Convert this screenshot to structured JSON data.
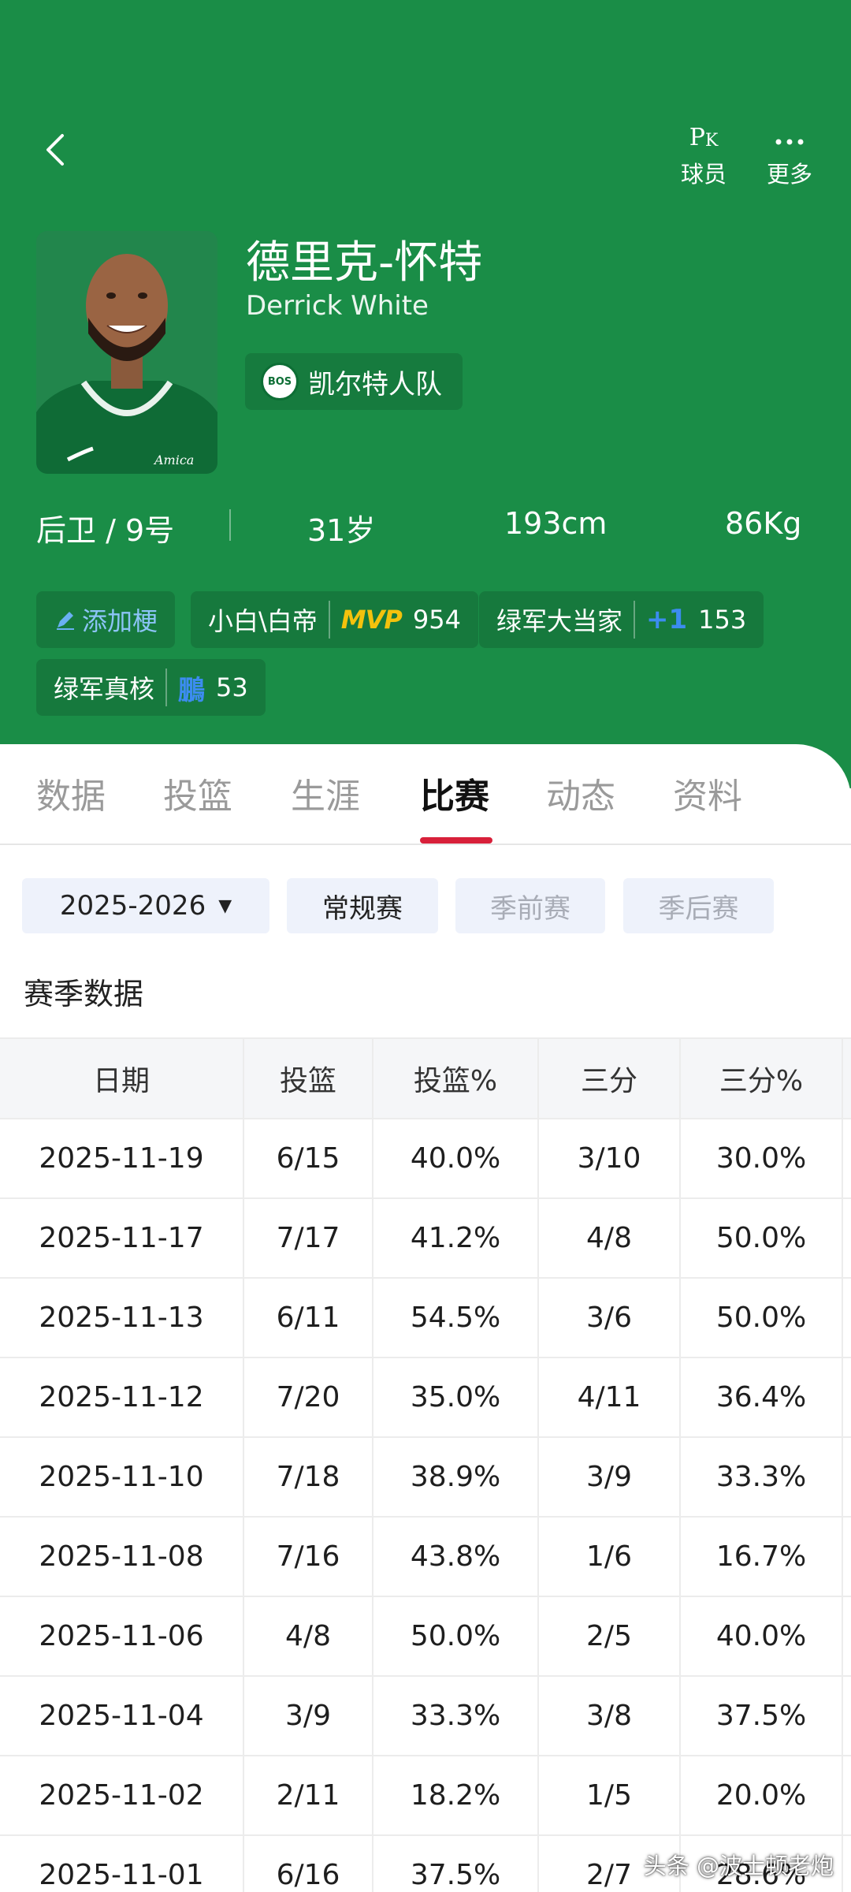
{
  "header": {
    "back_icon": "chevron-left-icon",
    "pk_button": {
      "icon": "pk-icon",
      "label": "球员"
    },
    "more_button": {
      "icon": "more-dots-icon",
      "label": "更多"
    },
    "accent": "#1a8d47"
  },
  "player": {
    "name_cn": "德里克-怀特",
    "name_en": "Derrick White",
    "team": "凯尔特人队",
    "team_logo_text": "BOS",
    "position_number": "后卫 / 9号",
    "age": "31岁",
    "height": "193cm",
    "weight": "86Kg"
  },
  "tags": {
    "add": "添加梗",
    "items": [
      {
        "label": "小白\\白帝",
        "badge": "MVP",
        "count": "954"
      },
      {
        "label": "绿军大当家",
        "badge": "+1",
        "count": "153"
      },
      {
        "label": "绿军真核",
        "badge": "鵬",
        "count": "53"
      }
    ]
  },
  "tabs": [
    {
      "label": "数据",
      "active": false
    },
    {
      "label": "投篮",
      "active": false
    },
    {
      "label": "生涯",
      "active": false
    },
    {
      "label": "比赛",
      "active": true
    },
    {
      "label": "动态",
      "active": false
    },
    {
      "label": "资料",
      "active": false
    }
  ],
  "filters": {
    "season": "2025-2026",
    "types": [
      "常规赛",
      "季前赛",
      "季后赛"
    ],
    "selected_type": "常规赛"
  },
  "section_title": "赛季数据",
  "table": {
    "columns": [
      "日期",
      "投篮",
      "投篮%",
      "三分",
      "三分%"
    ],
    "rows": [
      [
        "2025-11-19",
        "6/15",
        "40.0%",
        "3/10",
        "30.0%"
      ],
      [
        "2025-11-17",
        "7/17",
        "41.2%",
        "4/8",
        "50.0%"
      ],
      [
        "2025-11-13",
        "6/11",
        "54.5%",
        "3/6",
        "50.0%"
      ],
      [
        "2025-11-12",
        "7/20",
        "35.0%",
        "4/11",
        "36.4%"
      ],
      [
        "2025-11-10",
        "7/18",
        "38.9%",
        "3/9",
        "33.3%"
      ],
      [
        "2025-11-08",
        "7/16",
        "43.8%",
        "1/6",
        "16.7%"
      ],
      [
        "2025-11-06",
        "4/8",
        "50.0%",
        "2/5",
        "40.0%"
      ],
      [
        "2025-11-04",
        "3/9",
        "33.3%",
        "3/8",
        "37.5%"
      ],
      [
        "2025-11-02",
        "2/11",
        "18.2%",
        "1/5",
        "20.0%"
      ],
      [
        "2025-11-01",
        "6/16",
        "37.5%",
        "2/7",
        "28.6%"
      ]
    ]
  },
  "watermark": "头条 @波士顿老炮"
}
